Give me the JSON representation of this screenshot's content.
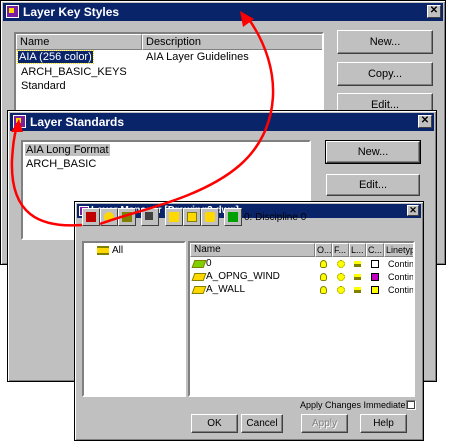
{
  "layer_key_styles": {
    "title": "Layer Key Styles",
    "columns": [
      "Name",
      "Description"
    ],
    "rows": [
      {
        "name": "AIA (256 color)",
        "description": "AIA Layer Guidelines"
      },
      {
        "name": "ARCH_BASIC_KEYS",
        "description": ""
      },
      {
        "name": "Standard",
        "description": ""
      }
    ],
    "buttons": {
      "new": "New...",
      "copy": "Copy...",
      "edit": "Edit..."
    }
  },
  "layer_standards": {
    "title": "Layer Standards",
    "rows": [
      "AIA Long Format",
      "ARCH_BASIC"
    ],
    "buttons": {
      "new": "New...",
      "edit": "Edit..."
    }
  },
  "layer_manager": {
    "title": "Layer Manager [Drawing3.dwg]",
    "current_layer": "0: Discipline 0",
    "tree_root": "All",
    "columns": [
      "Name",
      "O...",
      "F...",
      "L...",
      "C...",
      "Linetyp"
    ],
    "layers": [
      {
        "name": "0",
        "color": "#ffffff",
        "linetype": "Continu"
      },
      {
        "name": "A_OPNG_WIND",
        "color": "#c000c0",
        "linetype": "Continu"
      },
      {
        "name": "A_WALL",
        "color": "#ffff00",
        "linetype": "Continu"
      }
    ],
    "apply_label": "Apply Changes Immediately:",
    "buttons": {
      "ok": "OK",
      "cancel": "Cancel",
      "apply": "Apply",
      "help": "Help"
    }
  },
  "colors": {
    "titlebar": "#0a246a",
    "face": "#c0c0c0",
    "arrow": "#ff0000"
  }
}
